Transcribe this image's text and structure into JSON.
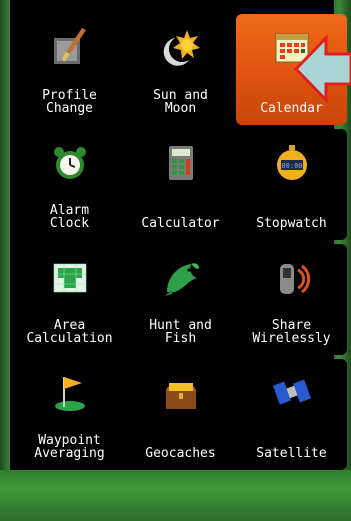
{
  "menu": {
    "tiles": [
      {
        "label": "Profile\nChange",
        "icon": "profile-brush-icon"
      },
      {
        "label": "Sun and\nMoon",
        "icon": "sun-moon-icon"
      },
      {
        "label": "Calendar",
        "icon": "calendar-icon",
        "selected": true
      },
      {
        "label": "Alarm\nClock",
        "icon": "alarm-clock-icon"
      },
      {
        "label": "Calculator",
        "icon": "calculator-icon"
      },
      {
        "label": "Stopwatch",
        "icon": "stopwatch-icon"
      },
      {
        "label": "Area\nCalculation",
        "icon": "area-calculation-icon"
      },
      {
        "label": "Hunt and\nFish",
        "icon": "fish-icon"
      },
      {
        "label": "Share\nWirelessly",
        "icon": "wireless-share-icon"
      },
      {
        "label": "Waypoint\nAveraging",
        "icon": "waypoint-flag-icon"
      },
      {
        "label": "Geocaches",
        "icon": "treasure-chest-icon"
      },
      {
        "label": "Satellite",
        "icon": "satellite-icon"
      }
    ]
  },
  "colors": {
    "selected_tile": "#e8601a",
    "callout_fill": "#a9d6d4",
    "callout_stroke": "#e02020"
  }
}
